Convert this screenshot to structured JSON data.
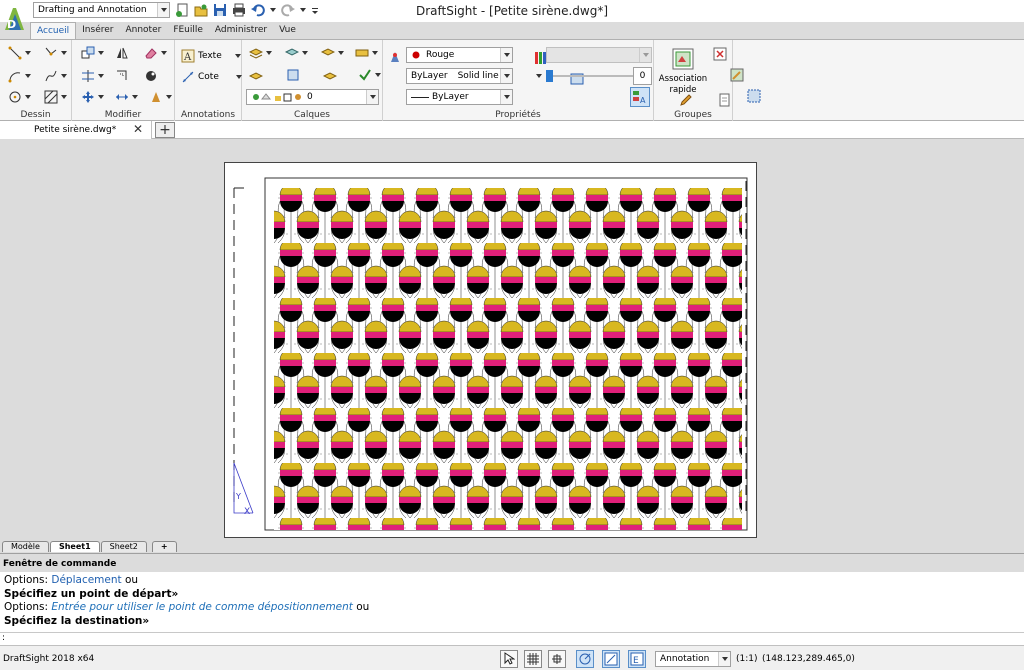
{
  "title_bar": {
    "workspace": "Drafting and Annotation",
    "app_title": "DraftSight - [Petite sirène.dwg*]"
  },
  "ribbon_tabs": [
    "Accueil",
    "Insérer",
    "Annoter",
    "FEuille",
    "Administrer",
    "Vue"
  ],
  "ribbon": {
    "groups": {
      "dessin": "Dessin",
      "modifier": "Modifier",
      "annotations": "Annotations",
      "calques": "Calques",
      "proprietes": "Propriétés",
      "groupes": "Groupes"
    },
    "annotations": {
      "texte": "Texte",
      "cote": "Cote"
    },
    "calques": {
      "layer_value": "0"
    },
    "proprietes": {
      "color": "Rouge",
      "color_hex": "#cc0000",
      "linetype_bylayer": "ByLayer",
      "linetype": "Solid line",
      "lineweight": "ByLayer",
      "transparency": "0"
    },
    "groupes": {
      "quick_group": "Association rapide"
    }
  },
  "document": {
    "tab": "Petite sirène.dwg*"
  },
  "layout_tabs": [
    "Modèle",
    "Sheet1",
    "Sheet2"
  ],
  "command_window": {
    "title": "Fenêtre de commande",
    "line1_prefix": "Options: ",
    "line1_link": "Déplacement",
    "line1_suffix": " ou",
    "line2": "Spécifiez un point de départ»",
    "line3_prefix": "Options: ",
    "line3_link": "Entrée pour utiliser le point de comme dépositionnement",
    "line3_suffix": " ou",
    "line4": "Spécifiez la destination»",
    "prompt": ":"
  },
  "status": {
    "app_version": "DraftSight 2018 x64",
    "annotation_scale": "Annotation",
    "scale": "(1:1)",
    "coordinates": "(148.123,289.465,0)"
  },
  "pattern_colors": {
    "yellow": "#d8b820",
    "magenta": "#e0207a",
    "black": "#000000",
    "green": "#3ca03c"
  }
}
